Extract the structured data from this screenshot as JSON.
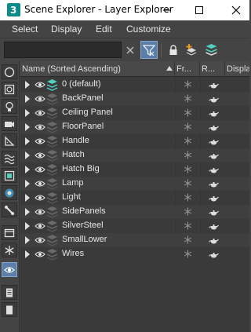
{
  "window": {
    "title": "Scene Explorer - Layer Explorer",
    "app_icon": "3ds-max-icon",
    "controls": [
      "minimize-icon",
      "maximize-icon",
      "close-icon"
    ]
  },
  "menu": {
    "items": [
      "Select",
      "Display",
      "Edit",
      "Customize"
    ]
  },
  "toolbar": {
    "search_value": "",
    "search_placeholder": "",
    "buttons": [
      "clear-icon",
      "filter-icon",
      "lock-icon",
      "add-layer-icon",
      "layers-stack-icon"
    ],
    "accent_color": "#5b7fa8"
  },
  "left_toolbar": {
    "buttons": [
      "sphere-icon",
      "shapes-icon",
      "light-bulb-icon",
      "camera-icon",
      "helper-ruler-icon",
      "spacewarp-icon",
      "group-icon",
      "xref-icon",
      "bone-icon",
      "container-icon",
      "freeze-snowflake-icon",
      "eye-icon",
      "list-icon",
      "square-icon"
    ]
  },
  "table": {
    "columns": {
      "name": "Name (Sorted Ascending)",
      "frozen": "Fr...",
      "renderable": "R...",
      "display": "Displa"
    },
    "rows": [
      {
        "name": "0 (default)",
        "active": true
      },
      {
        "name": "BackPanel",
        "active": false
      },
      {
        "name": "Ceiling Panel",
        "active": false
      },
      {
        "name": "FloorPanel",
        "active": false
      },
      {
        "name": "Handle",
        "active": false
      },
      {
        "name": "Hatch",
        "active": false
      },
      {
        "name": "Hatch Big",
        "active": false
      },
      {
        "name": "Lamp",
        "active": false
      },
      {
        "name": "Light",
        "active": false
      },
      {
        "name": "SidePanels",
        "active": false
      },
      {
        "name": "SilverSteel",
        "active": false
      },
      {
        "name": "SmallLower",
        "active": false
      },
      {
        "name": "Wires",
        "active": false
      }
    ]
  }
}
